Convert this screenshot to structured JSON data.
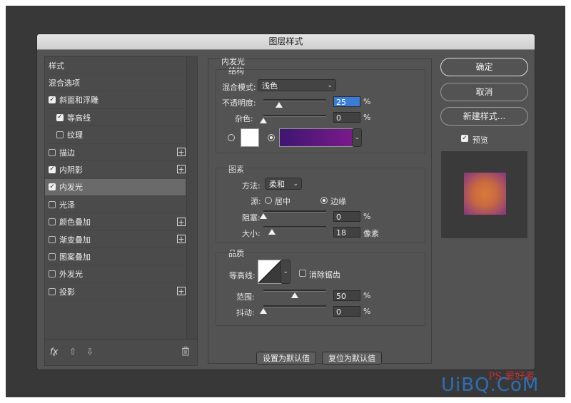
{
  "dialog": {
    "title": "图层样式"
  },
  "style_list": {
    "items": [
      {
        "label": "样式",
        "checkbox": false,
        "checked": false,
        "plus": false,
        "indent": 0,
        "selected": false
      },
      {
        "label": "混合选项",
        "checkbox": false,
        "checked": false,
        "plus": false,
        "indent": 0,
        "selected": false
      },
      {
        "label": "斜面和浮雕",
        "checkbox": true,
        "checked": true,
        "plus": false,
        "indent": 0,
        "selected": false
      },
      {
        "label": "等高线",
        "checkbox": true,
        "checked": true,
        "plus": false,
        "indent": 1,
        "selected": false
      },
      {
        "label": "纹理",
        "checkbox": true,
        "checked": false,
        "plus": false,
        "indent": 1,
        "selected": false
      },
      {
        "label": "描边",
        "checkbox": true,
        "checked": false,
        "plus": true,
        "indent": 0,
        "selected": false
      },
      {
        "label": "内阴影",
        "checkbox": true,
        "checked": true,
        "plus": true,
        "indent": 0,
        "selected": false
      },
      {
        "label": "内发光",
        "checkbox": true,
        "checked": true,
        "plus": false,
        "indent": 0,
        "selected": true
      },
      {
        "label": "光泽",
        "checkbox": true,
        "checked": false,
        "plus": false,
        "indent": 0,
        "selected": false
      },
      {
        "label": "颜色叠加",
        "checkbox": true,
        "checked": false,
        "plus": true,
        "indent": 0,
        "selected": false
      },
      {
        "label": "渐变叠加",
        "checkbox": true,
        "checked": false,
        "plus": true,
        "indent": 0,
        "selected": false
      },
      {
        "label": "图案叠加",
        "checkbox": true,
        "checked": false,
        "plus": false,
        "indent": 0,
        "selected": false
      },
      {
        "label": "外发光",
        "checkbox": true,
        "checked": false,
        "plus": false,
        "indent": 0,
        "selected": false
      },
      {
        "label": "投影",
        "checkbox": true,
        "checked": false,
        "plus": true,
        "indent": 0,
        "selected": false
      }
    ],
    "footer": {
      "fx": "fx",
      "up_icon": "arrow-up-icon",
      "down_icon": "arrow-down-icon",
      "trash_icon": "trash-icon"
    }
  },
  "inner_glow": {
    "section_title": "内发光",
    "structure": {
      "title": "结构",
      "blend_mode_label": "混合模式:",
      "blend_mode_value": "浅色",
      "opacity_label": "不透明度:",
      "opacity_value": "25",
      "opacity_percent": 0.25,
      "noise_label": "杂色:",
      "noise_value": "0",
      "noise_percent": 0.0,
      "unit": "%",
      "color_swatch": "#ffffff",
      "gradient_colors": [
        "#3d1670",
        "#7a1a8a"
      ]
    },
    "elements": {
      "title": "图素",
      "method_label": "方法:",
      "method_value": "柔和",
      "source_label": "源:",
      "source_center": "居中",
      "source_edge": "边缘",
      "choke_label": "阻塞:",
      "choke_value": "0",
      "size_label": "大小:",
      "size_value": "18",
      "size_unit": "像素",
      "unit": "%"
    },
    "quality": {
      "title": "品质",
      "contour_label": "等高线:",
      "antialias_label": "消除锯齿",
      "range_label": "范围:",
      "range_value": "50",
      "jitter_label": "抖动:",
      "jitter_value": "0",
      "unit": "%"
    },
    "buttons": {
      "set_default": "设置为默认值",
      "reset_default": "复位为默认值"
    }
  },
  "right_panel": {
    "ok": "确定",
    "cancel": "取消",
    "new_style": "新建样式...",
    "preview_label": "预览"
  },
  "watermark": {
    "text": "UiBQ.CoM",
    "sub": "PS 爱好者"
  }
}
